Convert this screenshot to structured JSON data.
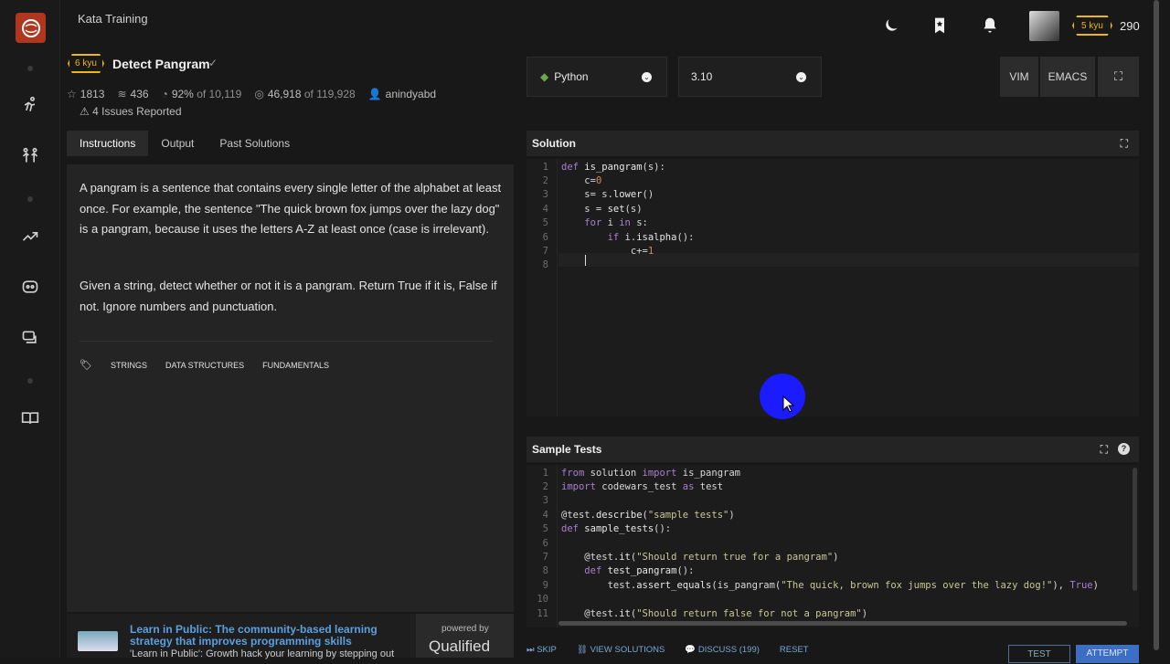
{
  "topbar": {
    "section": "Kata Training",
    "user_rank": "5 kyu",
    "honor": "290"
  },
  "kata": {
    "rank": "6 kyu",
    "title": "Detect Pangram",
    "stars": "1813",
    "collections": "436",
    "satisfaction": "92%",
    "satisfaction_of": "of 10,119",
    "completed": "46,918",
    "completed_of": "of 119,928",
    "author": "anindyabd",
    "issues": "4 Issues Reported"
  },
  "tabs": [
    "Instructions",
    "Output",
    "Past Solutions"
  ],
  "instructions": {
    "p1": "A pangram is a sentence that contains every single letter of the alphabet at least once. For example, the sentence \"The quick brown fox jumps over the lazy dog\" is a pangram, because it uses the letters A-Z at least once (case is irrelevant).",
    "p2": "Given a string, detect whether or not it is a pangram. Return True if it is, False if not. Ignore numbers and punctuation.",
    "tags": [
      "STRINGS",
      "DATA STRUCTURES",
      "FUNDAMENTALS"
    ]
  },
  "ad": {
    "title": "Learn in Public: The community-based learning strategy that improves programming skills",
    "desc": "'Learn in Public': Growth hack your learning by stepping out",
    "powered": "powered by",
    "brand": "Qualified"
  },
  "editor_bar": {
    "language": "Python",
    "version": "3.10",
    "vim": "VIM",
    "emacs": "EMACS"
  },
  "solution": {
    "title": "Solution",
    "lines": [
      "1",
      "2",
      "3",
      "4",
      "5",
      "6",
      "7",
      "8"
    ]
  },
  "sample_tests": {
    "title": "Sample Tests",
    "lines": [
      "1",
      "2",
      "3",
      "4",
      "5",
      "6",
      "7",
      "8",
      "9",
      "10",
      "11"
    ]
  },
  "bottom": {
    "skip": "SKIP",
    "view": "VIEW SOLUTIONS",
    "discuss": "DISCUSS (199)",
    "reset": "RESET",
    "test": "TEST",
    "attempt": "ATTEMPT"
  }
}
